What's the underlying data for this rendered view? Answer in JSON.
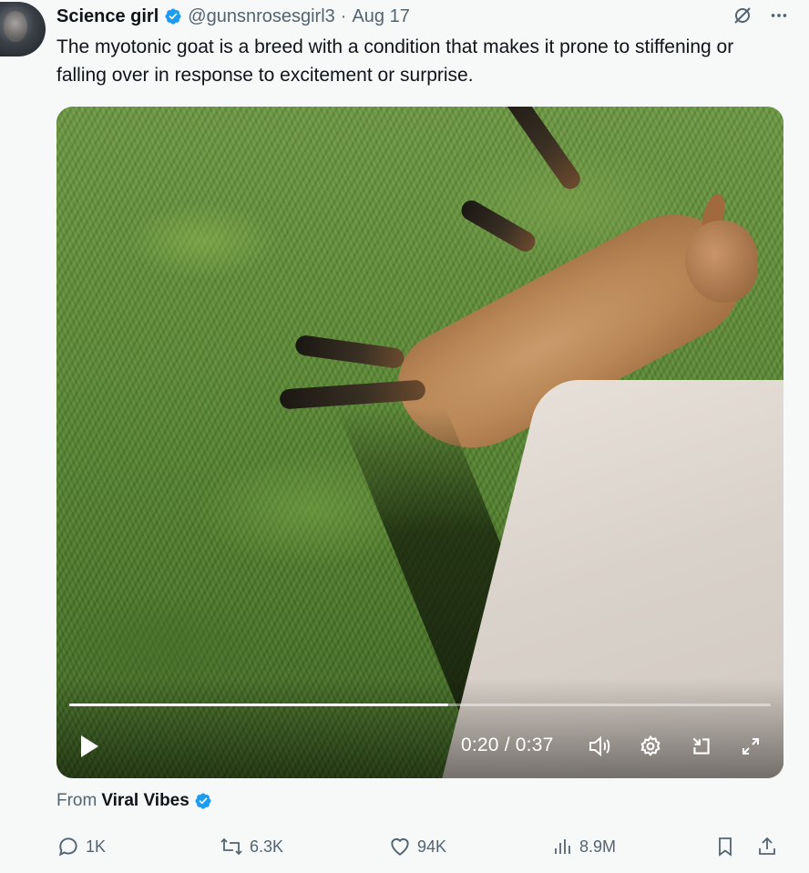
{
  "tweet": {
    "author_name": "Science girl",
    "handle": "@gunsnrosesgirl3",
    "separator": "·",
    "date": "Aug 17",
    "text": "The myotonic goat is a breed with a condition that makes it prone to stiffening or falling over in response to excitement or surprise."
  },
  "header_icons": [
    "grok-slash-icon",
    "more-icon"
  ],
  "video": {
    "time_display": "0:20 / 0:37",
    "progress_fraction": 0.54,
    "controls": [
      "play-icon",
      "volume-icon",
      "settings-icon",
      "pip-icon",
      "fullscreen-icon"
    ]
  },
  "source": {
    "prefix": "From",
    "name": "Viral Vibes"
  },
  "actions": {
    "replies": "1K",
    "reposts": "6.3K",
    "likes": "94K",
    "views": "8.9M"
  },
  "colors": {
    "verified_blue": "#1d9bf0",
    "secondary_text": "#536471",
    "primary_text": "#0f1419",
    "background": "#f7f9f9"
  }
}
